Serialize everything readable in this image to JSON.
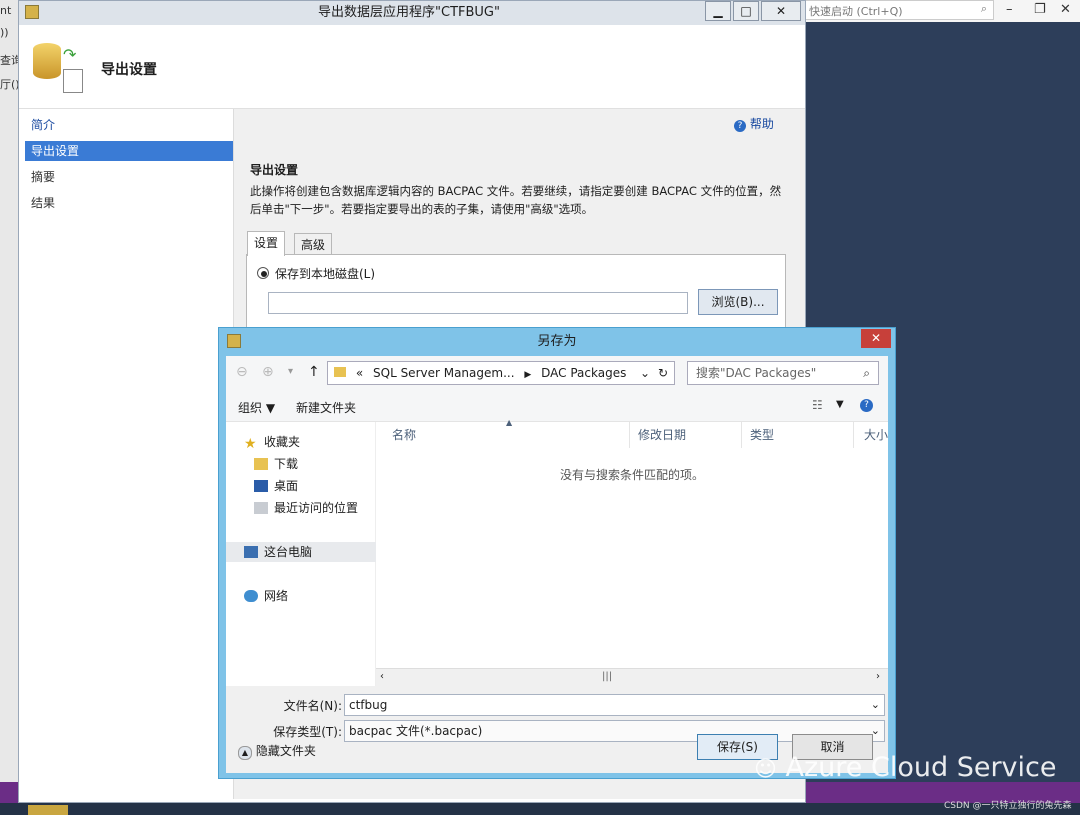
{
  "background": {
    "left_strip": [
      "nt",
      "))",
      "查询",
      "厅()"
    ],
    "quick_launch": "快速启动 (Ctrl+Q)"
  },
  "wizard": {
    "title": "导出数据层应用程序\"CTFBUG\"",
    "header_title": "导出设置",
    "nav": [
      "简介",
      "导出设置",
      "摘要",
      "结果"
    ],
    "help": "帮助",
    "section_title": "导出设置",
    "section_desc": "此操作将创建包含数据库逻辑内容的 BACPAC 文件。若要继续，请指定要创建 BACPAC 文件的位置，然后单击\"下一步\"。若要指定要导出的表的子集，请使用\"高级\"选项。",
    "tabs": [
      "设置",
      "高级"
    ],
    "radio_local": "保存到本地磁盘(L)",
    "path_value": "",
    "browse": "浏览(B)..."
  },
  "dialog": {
    "title": "另存为",
    "breadcrumb_prefix": "«",
    "breadcrumb": [
      "SQL Server Managem...",
      "DAC Packages"
    ],
    "search_placeholder": "搜索\"DAC Packages\"",
    "organize": "组织 ▼",
    "new_folder": "新建文件夹",
    "nav_pane": [
      "收藏夹",
      "下载",
      "桌面",
      "最近访问的位置",
      "这台电脑",
      "网络"
    ],
    "columns": [
      "名称",
      "修改日期",
      "类型",
      "大小"
    ],
    "empty_message": "没有与搜索条件匹配的项。",
    "filename_label": "文件名(N):",
    "filename_value": "ctfbug",
    "filetype_label": "保存类型(T):",
    "filetype_value": "bacpac 文件(*.bacpac)",
    "hide_folders": "隐藏文件夹",
    "save": "保存(S)",
    "cancel": "取消"
  },
  "watermark": "Azure Cloud Service",
  "csdn": "CSDN @一只特立独行的兔先森"
}
